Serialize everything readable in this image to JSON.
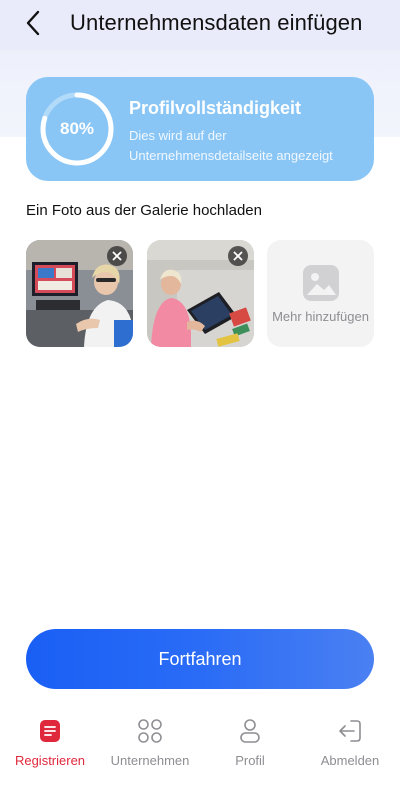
{
  "header": {
    "title": "Unternehmensdaten einfügen",
    "back_icon": "chevron-left-icon"
  },
  "profile_card": {
    "progress_text": "80%",
    "progress_fraction": 0.8,
    "title": "Profilvollständigkeit",
    "description": "Dies wird auf der Unternehmensdetailseite angezeigt",
    "color": "#89c6f6"
  },
  "gallery": {
    "label": "Ein Foto aus der Galerie hochladen",
    "photos": [
      {
        "remove_icon": "close-icon"
      },
      {
        "remove_icon": "close-icon"
      }
    ],
    "add_more_label": "Mehr hinzufügen",
    "add_more_icon": "image-icon"
  },
  "continue_button": {
    "label": "Fortfahren"
  },
  "bottom_nav": {
    "items": [
      {
        "label": "Registrieren",
        "icon": "document-icon",
        "active": true
      },
      {
        "label": "Unternehmen",
        "icon": "grid-icon",
        "active": false
      },
      {
        "label": "Profil",
        "icon": "person-icon",
        "active": false
      },
      {
        "label": "Abmelden",
        "icon": "logout-icon",
        "active": false
      }
    ],
    "active_color": "#e0283c"
  }
}
